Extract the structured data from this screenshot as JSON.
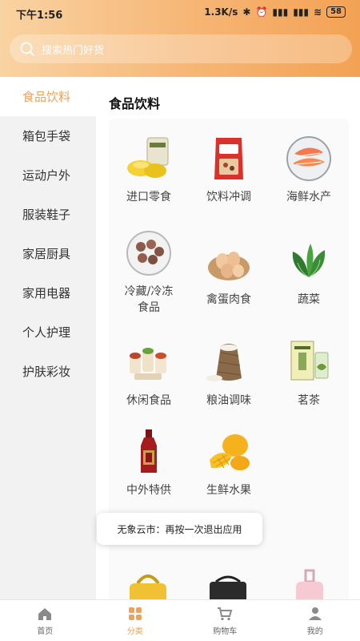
{
  "status": {
    "time": "下午1:56",
    "speed": "1.3K/s",
    "battery": "58"
  },
  "search": {
    "placeholder": "搜索热门好货"
  },
  "sidebar": {
    "items": [
      {
        "label": "食品饮料"
      },
      {
        "label": "箱包手袋"
      },
      {
        "label": "运动户外"
      },
      {
        "label": "服装鞋子"
      },
      {
        "label": "家居厨具"
      },
      {
        "label": "家用电器"
      },
      {
        "label": "个人护理"
      },
      {
        "label": "护肤彩妆"
      }
    ]
  },
  "content": {
    "section_title": "食品饮料",
    "categories": [
      {
        "label": "进口零食",
        "icon": "snacks-icon"
      },
      {
        "label": "饮料冲调",
        "icon": "cereal-bag-icon"
      },
      {
        "label": "海鲜水产",
        "icon": "seafood-icon"
      },
      {
        "label": "冷藏/冷冻食品",
        "icon": "meatballs-icon"
      },
      {
        "label": "禽蛋肉食",
        "icon": "eggs-icon"
      },
      {
        "label": "蔬菜",
        "icon": "vegetable-icon"
      },
      {
        "label": "休闲食品",
        "icon": "rolls-icon"
      },
      {
        "label": "粮油调味",
        "icon": "rice-sack-icon"
      },
      {
        "label": "茗茶",
        "icon": "tea-icon"
      },
      {
        "label": "中外特供",
        "icon": "liquor-icon"
      },
      {
        "label": "生鲜水果",
        "icon": "mango-icon"
      }
    ]
  },
  "toast": {
    "message": "无象云市：再按一次退出应用"
  },
  "tabbar": {
    "items": [
      {
        "label": "首页"
      },
      {
        "label": "分类"
      },
      {
        "label": "购物车"
      },
      {
        "label": "我的"
      }
    ]
  },
  "colors": {
    "accent": "#e9a35e",
    "header_start": "#f9d3a2",
    "header_end": "#f3a254"
  }
}
